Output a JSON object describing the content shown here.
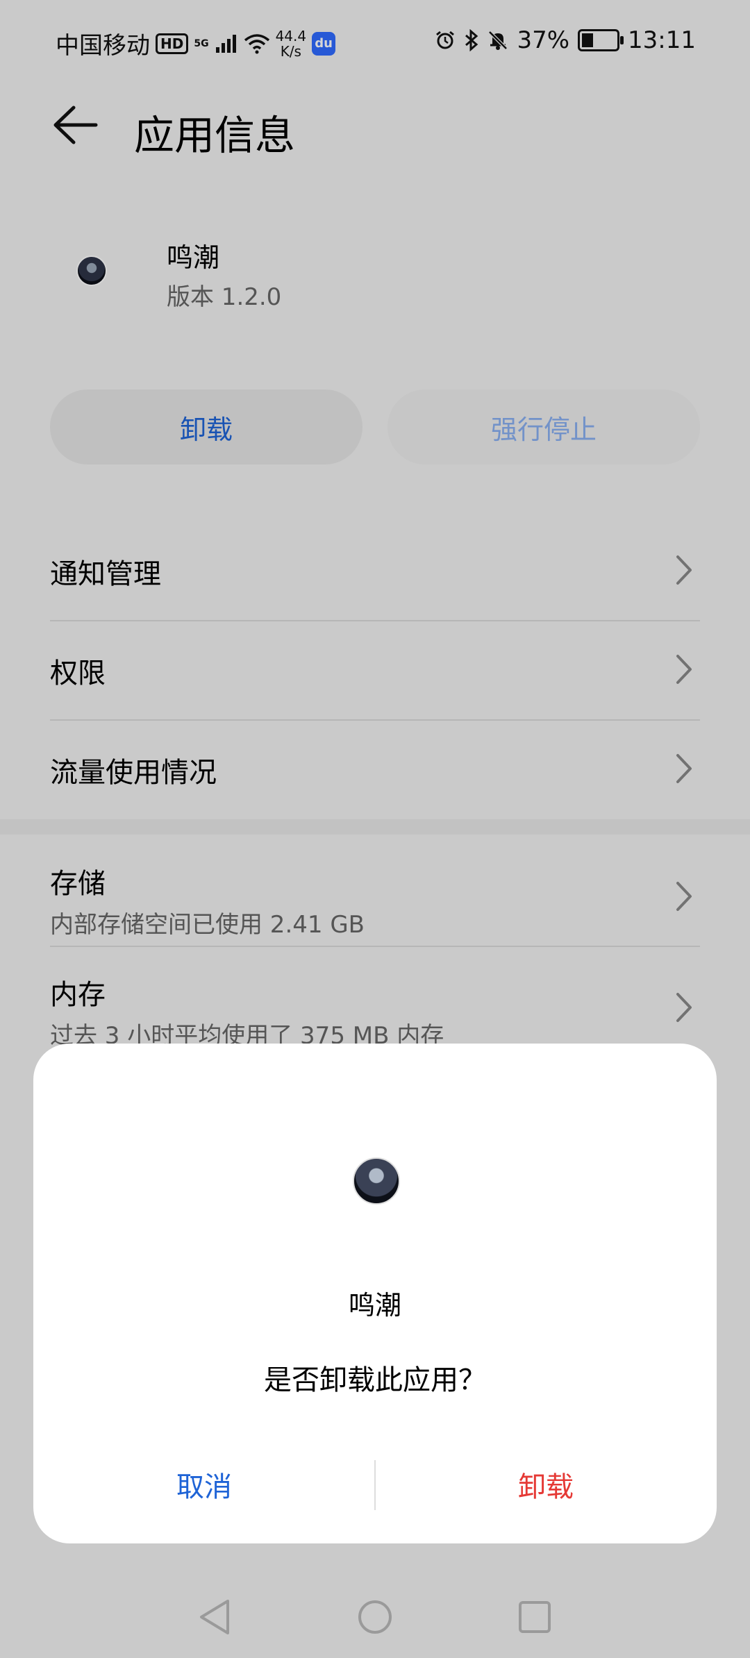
{
  "status_bar": {
    "carrier": "中国移动",
    "hd_badge": "HD",
    "network": "5G",
    "speed_value": "44.4",
    "speed_unit": "K/s",
    "baidu_icon_text": "du",
    "battery": "37%",
    "time": "13:11"
  },
  "header": {
    "title": "应用信息"
  },
  "app": {
    "name": "鸣潮",
    "version": "版本 1.2.0"
  },
  "actions": {
    "uninstall": "卸载",
    "force_stop": "强行停止"
  },
  "settings": [
    {
      "label": "通知管理"
    },
    {
      "label": "权限"
    },
    {
      "label": "流量使用情况"
    },
    {
      "label": "存储",
      "sub": "内部存储空间已使用 2.41 GB"
    },
    {
      "label": "内存",
      "sub": "过去 3 小时平均使用了 375 MB 内存"
    }
  ],
  "dialog": {
    "app_name": "鸣潮",
    "message": "是否卸载此应用？",
    "cancel": "取消",
    "confirm": "卸载"
  },
  "colors": {
    "accent": "#1e63d6",
    "danger": "#e53935"
  }
}
